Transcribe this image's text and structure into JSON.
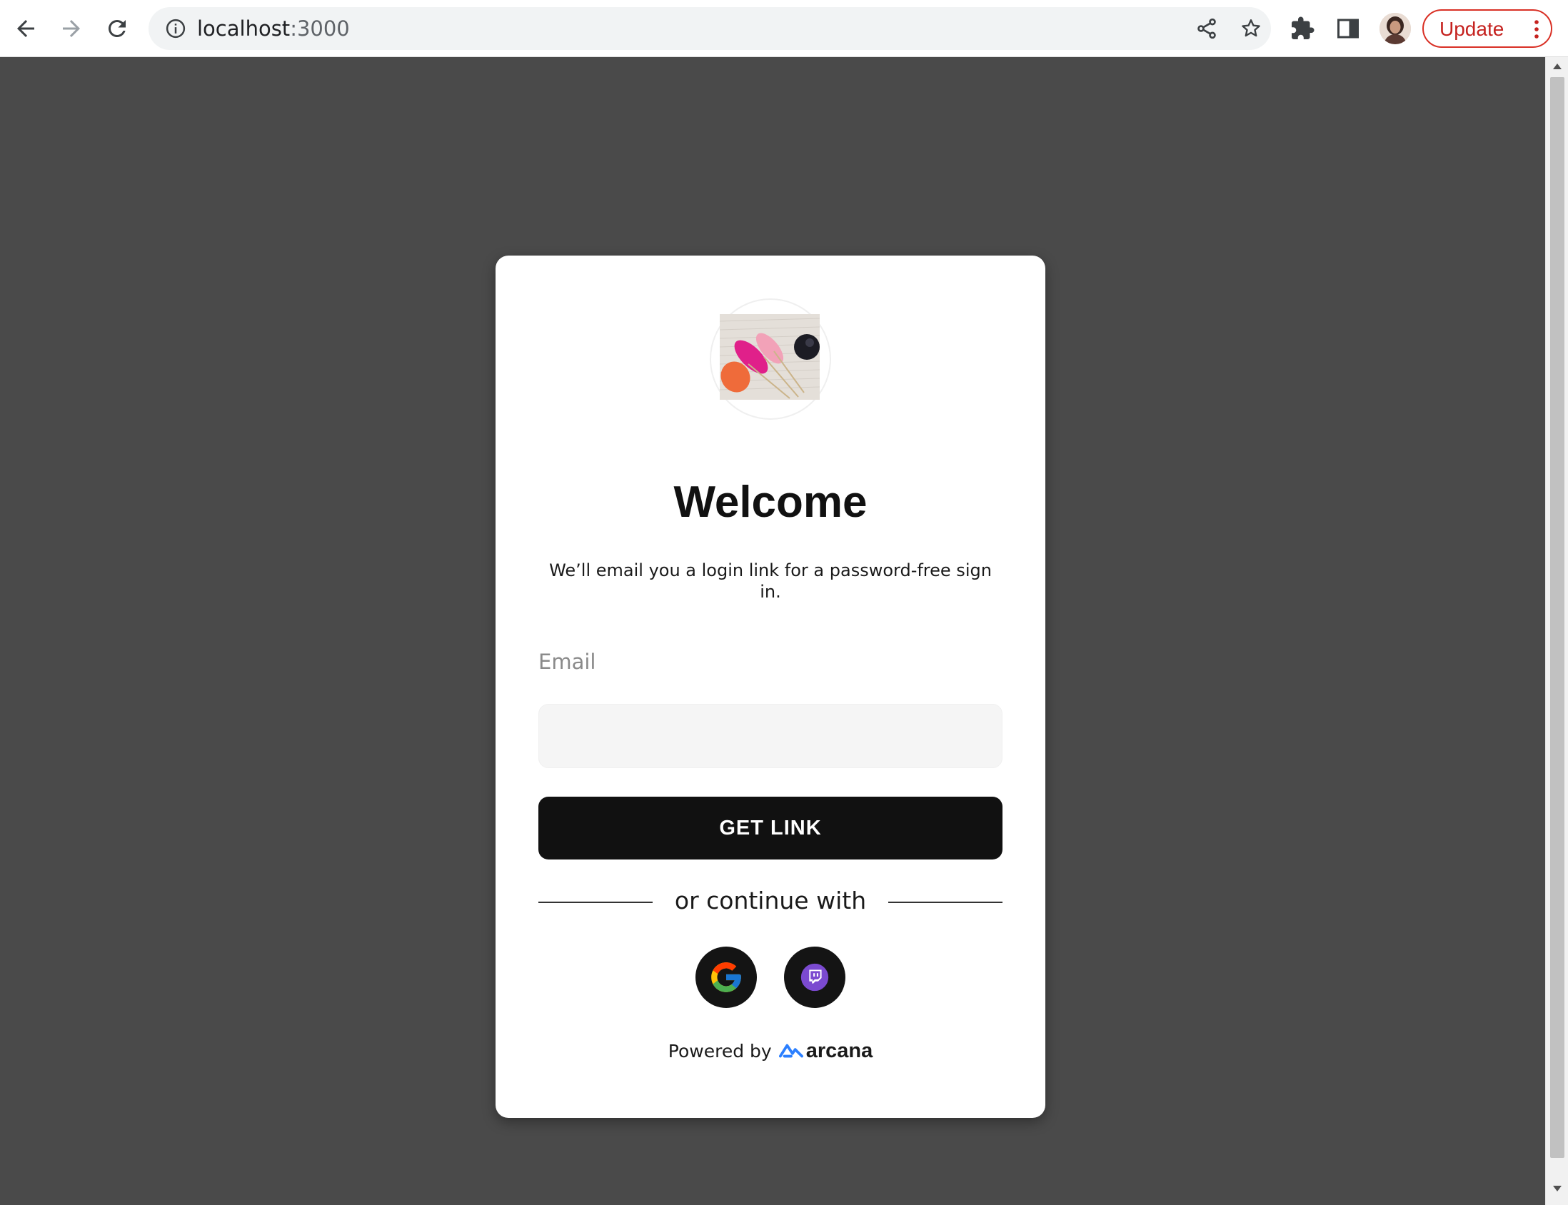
{
  "browser": {
    "url_host": "localhost",
    "url_port": ":3000",
    "update_label": "Update",
    "icons": {
      "back": "arrow-left-icon",
      "forward": "arrow-right-icon",
      "reload": "reload-icon",
      "site_info": "info-icon",
      "share": "share-icon",
      "bookmark": "star-icon",
      "extensions": "puzzle-icon",
      "side_panel": "side-panel-icon",
      "menu": "kebab-menu-icon"
    }
  },
  "page": {
    "background": "#4a4a4a",
    "card": {
      "title": "Welcome",
      "subtitle": "We’ll email you a login link for a password-free sign in.",
      "email_label": "Email",
      "email_value": "",
      "email_placeholder": "",
      "submit_label": "GET LINK",
      "divider_text": "or continue with",
      "social_providers": [
        "google",
        "twitch"
      ],
      "powered_by_label": "Powered by",
      "powered_by_brand": "arcana"
    }
  },
  "colors": {
    "button_bg": "#111111",
    "update_red": "#d93025",
    "arcana_blue": "#2b7fff",
    "twitch_purple": "#7b4ad0"
  }
}
